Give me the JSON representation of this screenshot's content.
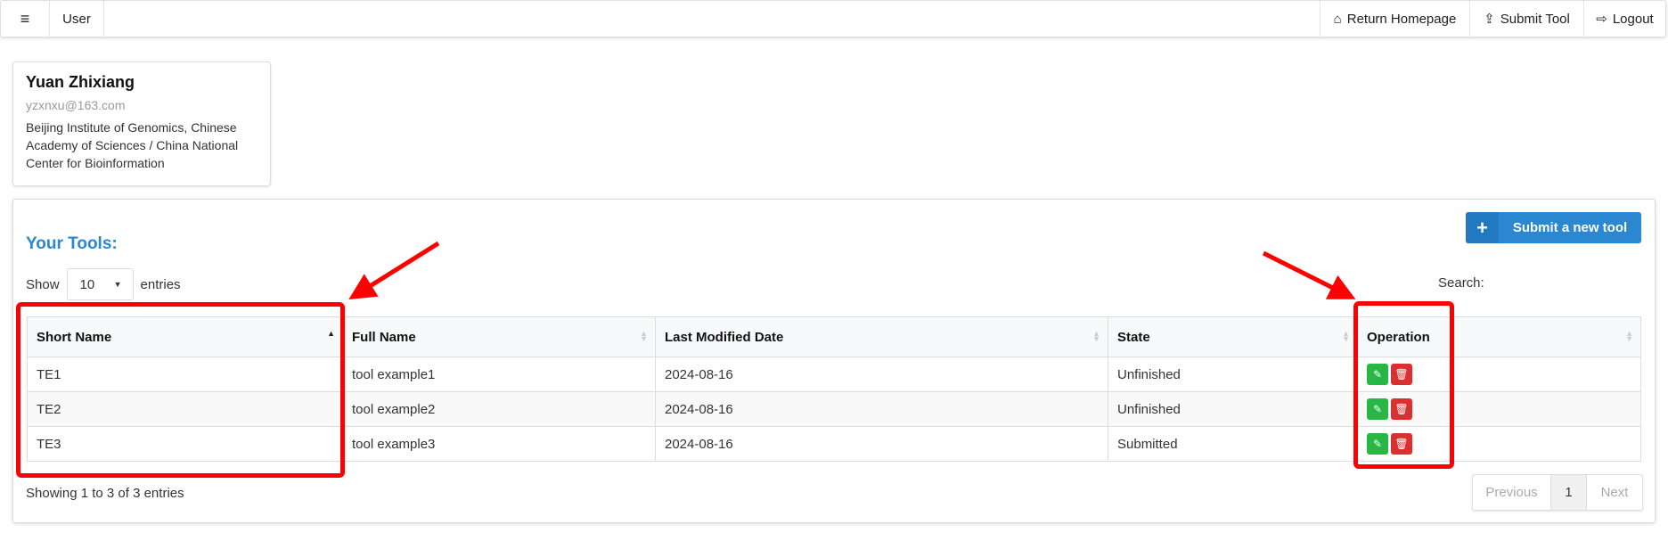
{
  "navbar": {
    "menu_icon": "hamburger-icon",
    "user_label": "User",
    "right": [
      {
        "label": "Return Homepage",
        "icon": "home-icon"
      },
      {
        "label": "Submit Tool",
        "icon": "upload-icon"
      },
      {
        "label": "Logout",
        "icon": "logout-icon"
      }
    ]
  },
  "profile": {
    "name": "Yuan Zhixiang",
    "email": "yzxnxu@163.com",
    "institution": "Beijing Institute of Genomics, Chinese Academy of Sciences / China National Center for Bioinformation"
  },
  "tools": {
    "title": "Your Tools:",
    "submit_button": "Submit a new tool",
    "show_label": "Show",
    "entries_label": "entries",
    "page_length": "10",
    "search_label": "Search:",
    "columns": [
      "Short Name",
      "Full Name",
      "Last Modified Date",
      "State",
      "Operation"
    ],
    "rows": [
      {
        "short": "TE1",
        "full": "tool example1",
        "date": "2024-08-16",
        "state": "Unfinished"
      },
      {
        "short": "TE2",
        "full": "tool example2",
        "date": "2024-08-16",
        "state": "Unfinished"
      },
      {
        "short": "TE3",
        "full": "tool example3",
        "date": "2024-08-16",
        "state": "Submitted"
      }
    ],
    "info": "Showing 1 to 3 of 3 entries",
    "pagination": {
      "previous": "Previous",
      "current": "1",
      "next": "Next"
    }
  },
  "colors": {
    "accent": "#2a87d0",
    "edit": "#28b745",
    "delete": "#dc2f2f",
    "annotation": "#ff0000"
  }
}
